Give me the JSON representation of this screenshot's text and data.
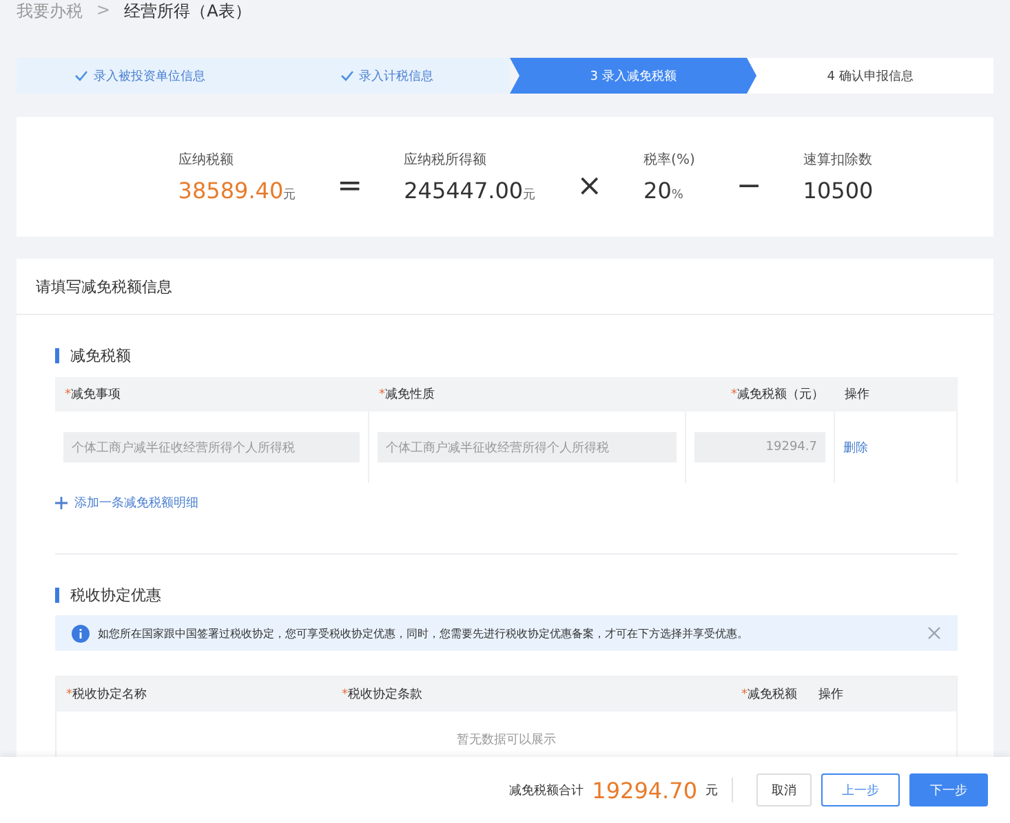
{
  "breadcrumb": [
    {
      "label": "我要办税",
      "current": false
    },
    {
      "label": "经营所得（A表）",
      "current": true
    }
  ],
  "breadcrumb_separator": ">",
  "steps": [
    {
      "label": "录入被投资单位信息",
      "completed": true,
      "selected": false
    },
    {
      "label": "录入计税信息",
      "completed": true,
      "selected": false
    },
    {
      "label": "3 录入减免税额",
      "completed": false,
      "selected": true
    },
    {
      "label": "4 确认申报信息",
      "completed": false,
      "selected": false
    }
  ],
  "formula": [
    {
      "kind": "term",
      "label": "应纳税额",
      "value": "38589.40",
      "unit": "元",
      "highlight": true
    },
    {
      "kind": "operator",
      "symbol": "="
    },
    {
      "kind": "term",
      "label": "应纳税所得额",
      "value": "245447.00",
      "unit": "元",
      "highlight": false
    },
    {
      "kind": "operator",
      "symbol": "×"
    },
    {
      "kind": "term",
      "label": "税率(%)",
      "value": "20",
      "unit": "%",
      "highlight": false
    },
    {
      "kind": "operator",
      "symbol": "−"
    },
    {
      "kind": "term",
      "label": "速算扣除数",
      "value": "10500",
      "highlight": false
    }
  ],
  "form_title": "请填写减免税额信息",
  "reduction": {
    "title": "减免税额",
    "columns": [
      {
        "label": "减免事项",
        "required_mark": "*"
      },
      {
        "label": "减免性质",
        "required_mark": "*"
      },
      {
        "label": "减免税额（元）",
        "required_mark": "*"
      },
      {
        "label": "操作"
      }
    ],
    "rows": [
      {
        "item": "个体工商户减半征收经营所得个人所得税",
        "nature": "个体工商户减半征收经营所得个人所得税",
        "amount": "19294.7",
        "action": "删除"
      }
    ],
    "add_link": "添加一条减免税额明细"
  },
  "treaty": {
    "title": "税收协定优惠",
    "notice": "如您所在国家跟中国签署过税收协定，您可享受税收协定优惠，同时，您需要先进行税收协定优惠备案，才可在下方选择并享受优惠。",
    "columns": [
      {
        "label": "税收协定名称",
        "required_mark": "*"
      },
      {
        "label": "税收协定条款",
        "required_mark": "*"
      },
      {
        "label": "减免税额",
        "required_mark": "*"
      },
      {
        "label": "操作"
      }
    ],
    "empty_text": "暂无数据可以展示"
  },
  "footer": {
    "total_label": "减免税额合计",
    "total_value": "19294.70",
    "total_unit": "元",
    "buttons": [
      {
        "label": "取消",
        "kind": "plain"
      },
      {
        "label": "上一步",
        "kind": "outline"
      },
      {
        "label": "下一步",
        "kind": "primary"
      }
    ]
  }
}
